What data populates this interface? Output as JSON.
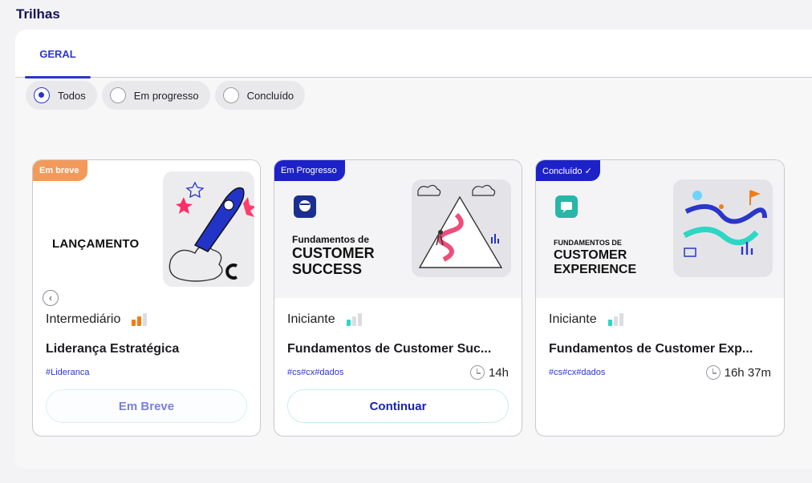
{
  "page": {
    "title": "Trilhas"
  },
  "tabs": [
    {
      "label": "GERAL",
      "active": true
    }
  ],
  "filters": [
    {
      "label": "Todos",
      "selected": true
    },
    {
      "label": "Em progresso",
      "selected": false
    },
    {
      "label": "Concluído",
      "selected": false
    }
  ],
  "cards": [
    {
      "status": "Em breve",
      "banner_title": "LANÇAMENTO",
      "banner_title_small": "",
      "level": "Intermediário",
      "level_bars": 2,
      "name": "Liderança Estratégica",
      "tags": "#Lideranca",
      "duration": "",
      "action": "Em Breve"
    },
    {
      "status": "Em Progresso",
      "banner_title_small": "Fundamentos de",
      "banner_title": "CUSTOMER SUCCESS",
      "level": "Iniciante",
      "level_bars": 1,
      "name": "Fundamentos de Customer Suc...",
      "tags": "#cs#cx#dados",
      "duration": "14h",
      "action": "Continuar"
    },
    {
      "status": "Concluído ✓",
      "banner_title_small": "FUNDAMENTOS DE",
      "banner_title": "CUSTOMER EXPERIENCE",
      "level": "Iniciante",
      "level_bars": 1,
      "name": "Fundamentos de Customer Exp...",
      "tags": "#cs#cx#dados",
      "duration": "16h 37m",
      "action": ""
    }
  ],
  "colors": {
    "accent": "#2b36c9",
    "badge_soon": "#f39a5b",
    "badge_progress": "#1d22c8",
    "level_orange": "#f07d1a",
    "level_teal": "#2ed6c4"
  },
  "icons": [
    "chevron-left-icon",
    "clock-icon",
    "rocket-illustration",
    "mountain-illustration",
    "journey-illustration"
  ]
}
